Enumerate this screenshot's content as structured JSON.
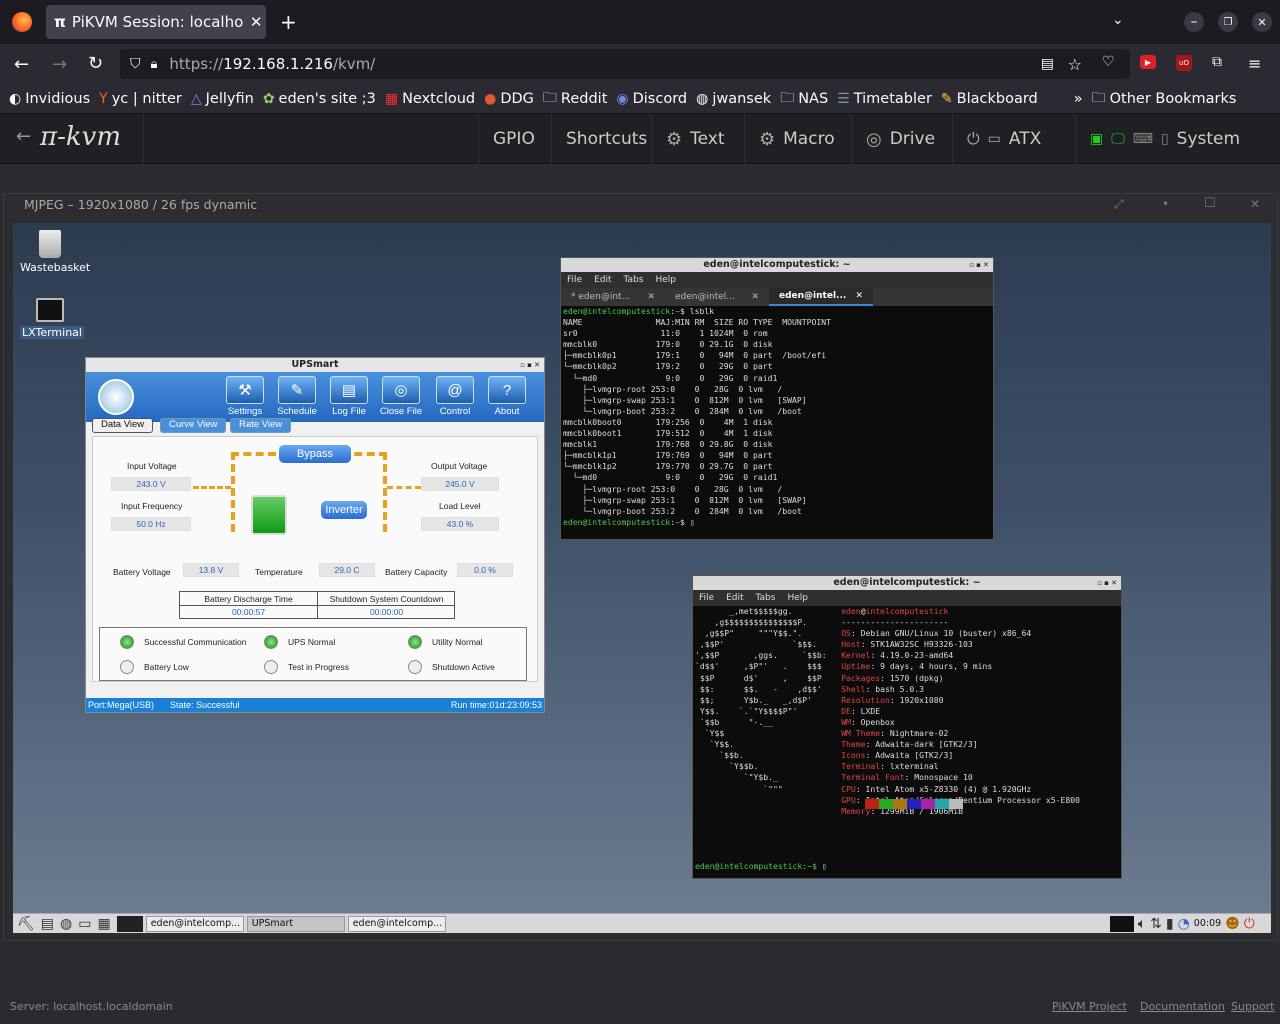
{
  "browser": {
    "tab_title": "PiKVM Session: localhost",
    "url_prefix": "https://",
    "url_host": "192.168.1.216",
    "url_path": "/kvm/",
    "bookmarks": [
      "Invidious",
      "yc | nitter",
      "Jellyfin",
      "eden's site ;3",
      "Nextcloud",
      "DDG",
      "Reddit",
      "Discord",
      "jwansek",
      "NAS",
      "Timetabler",
      "Blackboard"
    ],
    "other_bookmarks": "Other Bookmarks"
  },
  "kvm": {
    "logo": "π-kvm",
    "menu": {
      "gpio": "GPIO",
      "shortcuts": "Shortcuts",
      "text": "Text",
      "macro": "Macro",
      "drive": "Drive",
      "atx": "ATX",
      "system": "System"
    },
    "stream_title": "MJPEG – 1920x1080 / 26 fps dynamic",
    "footer_server": "Server: localhost.localdomain",
    "footer_links": {
      "project": "PiKVM Project",
      "docs": "Documentation",
      "support": "Support"
    }
  },
  "desktop": {
    "icons": [
      "Wastebasket",
      "LXTerminal"
    ],
    "taskbar": {
      "items": [
        "eden@intelcomp...",
        "UPSmart",
        "eden@intelcomp..."
      ],
      "clock": "00:09"
    }
  },
  "terminal1": {
    "title": "eden@intelcomputestick: ~",
    "menu": [
      "File",
      "Edit",
      "Tabs",
      "Help"
    ],
    "tabs": [
      "* eden@int...",
      "eden@intel...",
      "eden@intel..."
    ]
  },
  "terminal2": {
    "title": "eden@intelcomputestick: ~",
    "menu": [
      "File",
      "Edit",
      "Tabs",
      "Help"
    ],
    "prompt": "eden@intelcomputestick:~$"
  },
  "ups": {
    "title": "UPSmart",
    "tools": [
      "Settings",
      "Schedule",
      "Log File",
      "Close File",
      "Control",
      "About"
    ],
    "tabs": [
      "Data View",
      "Curve View",
      "Rate View"
    ],
    "input_voltage_label": "Input Voltage",
    "input_voltage": "243.0 V",
    "input_freq_label": "Input Frequency",
    "input_freq": "50.0 Hz",
    "output_voltage_label": "Output Voltage",
    "output_voltage": "245.0 V",
    "load_level_label": "Load Level",
    "load_level": "43.0 %",
    "bypass": "Bypass",
    "inverter": "Inverter",
    "battery_voltage_label": "Battery Voltage",
    "battery_voltage": "13.8 V",
    "temperature_label": "Temperature",
    "temperature": "29.0 C",
    "battery_capacity_label": "Battery Capacity",
    "battery_capacity": "0.0 %",
    "discharge_label": "Battery Discharge Time",
    "discharge": "00:00:57",
    "shutdown_label": "Shutdown System Countdown",
    "shutdown": "00:00:00",
    "status": [
      "Successful Communication",
      "UPS Normal",
      "Utility Normal",
      "Battery Low",
      "Test in Progress",
      "Shutdown Active"
    ],
    "footer_port": "Port:Mega(USB)",
    "footer_state": "State: Successful",
    "footer_runtime": "Run time:01d:23:09:53"
  }
}
